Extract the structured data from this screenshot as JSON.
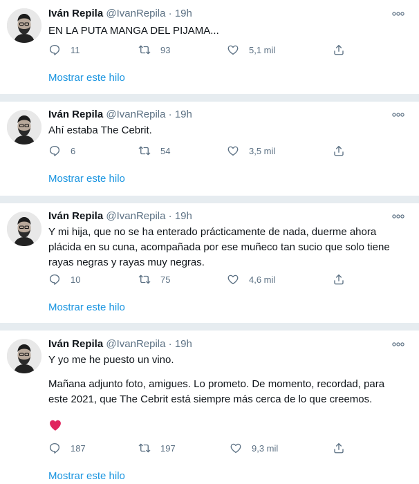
{
  "tweets": [
    {
      "name": "Iván Repila",
      "handle": "@IvanRepila",
      "dot": "·",
      "time": "19h",
      "text": [
        "EN LA PUTA MANGA DEL PIJAMA..."
      ],
      "replies": "11",
      "retweets": "93",
      "likes": "5,1 mil",
      "thread_link": "Mostrar este hilo"
    },
    {
      "name": "Iván Repila",
      "handle": "@IvanRepila",
      "dot": "·",
      "time": "19h",
      "text": [
        "Ahí estaba The Cebrit."
      ],
      "replies": "6",
      "retweets": "54",
      "likes": "3,5 mil",
      "thread_link": "Mostrar este hilo"
    },
    {
      "name": "Iván Repila",
      "handle": "@IvanRepila",
      "dot": "·",
      "time": "19h",
      "text": [
        "Y mi hija, que no se ha enterado prácticamente de nada, duerme ahora plácida en su cuna, acompañada por ese muñeco tan sucio que solo tiene rayas negras y rayas muy negras."
      ],
      "replies": "10",
      "retweets": "75",
      "likes": "4,6 mil",
      "thread_link": "Mostrar este hilo"
    },
    {
      "name": "Iván Repila",
      "handle": "@IvanRepila",
      "dot": "·",
      "time": "19h",
      "text": [
        "Y yo me he puesto un vino.",
        "Mañana adjunto foto, amigues. Lo prometo. De momento, recordad, para este 2021, que The Cebrit está siempre más cerca de lo que creemos."
      ],
      "emoji": "red-heart",
      "replies": "187",
      "retweets": "197",
      "likes": "9,3 mil",
      "thread_link": "Mostrar este hilo"
    }
  ],
  "colors": {
    "text": "#0f1419",
    "muted": "#5b7083",
    "link": "#1b95e0",
    "separator": "#e6ecf0",
    "heart": "#e0245e"
  },
  "icons": [
    "reply-icon",
    "retweet-icon",
    "like-icon",
    "share-icon",
    "more-icon",
    "heart-emoji-icon"
  ]
}
